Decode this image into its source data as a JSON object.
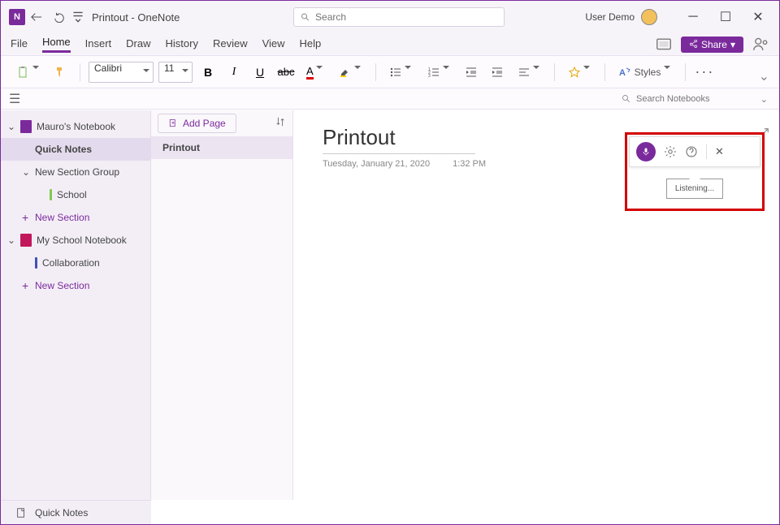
{
  "titlebar": {
    "app_badge": "N",
    "title": "Printout  -  OneNote",
    "search_placeholder": "Search",
    "user_name": "User Demo"
  },
  "menubar": {
    "items": [
      "File",
      "Home",
      "Insert",
      "Draw",
      "History",
      "Review",
      "View",
      "Help"
    ],
    "active_index": 1,
    "share_label": "Share"
  },
  "toolbar": {
    "font_name": "Calibri",
    "font_size": "11",
    "styles_label": "Styles"
  },
  "subbar": {
    "search_placeholder": "Search Notebooks"
  },
  "sidebar": {
    "items": [
      {
        "type": "notebook",
        "label": "Mauro's Notebook",
        "color": "#7b2a9c",
        "expanded": true,
        "indent": 0
      },
      {
        "type": "section",
        "label": "Quick Notes",
        "selected": true,
        "indent": 1
      },
      {
        "type": "sectiongroup",
        "label": "New Section Group",
        "expanded": true,
        "indent": 1
      },
      {
        "type": "section",
        "label": "School",
        "color": "#84c84f",
        "indent": 2
      },
      {
        "type": "new",
        "label": "New Section",
        "indent": 1
      },
      {
        "type": "notebook",
        "label": "My  School Notebook",
        "color": "#c2185b",
        "expanded": true,
        "indent": 0
      },
      {
        "type": "section",
        "label": "Collaboration",
        "color": "#3f51b5",
        "indent": 1
      },
      {
        "type": "new",
        "label": "New Section",
        "indent": 1
      }
    ]
  },
  "pages": {
    "add_label": "Add Page",
    "items": [
      {
        "label": "Printout",
        "selected": true
      }
    ]
  },
  "canvas": {
    "title": "Printout",
    "date": "Tuesday, January 21, 2020",
    "time": "1:32 PM"
  },
  "dictation": {
    "tooltip": "Listening..."
  },
  "footer": {
    "label": "Quick Notes"
  }
}
